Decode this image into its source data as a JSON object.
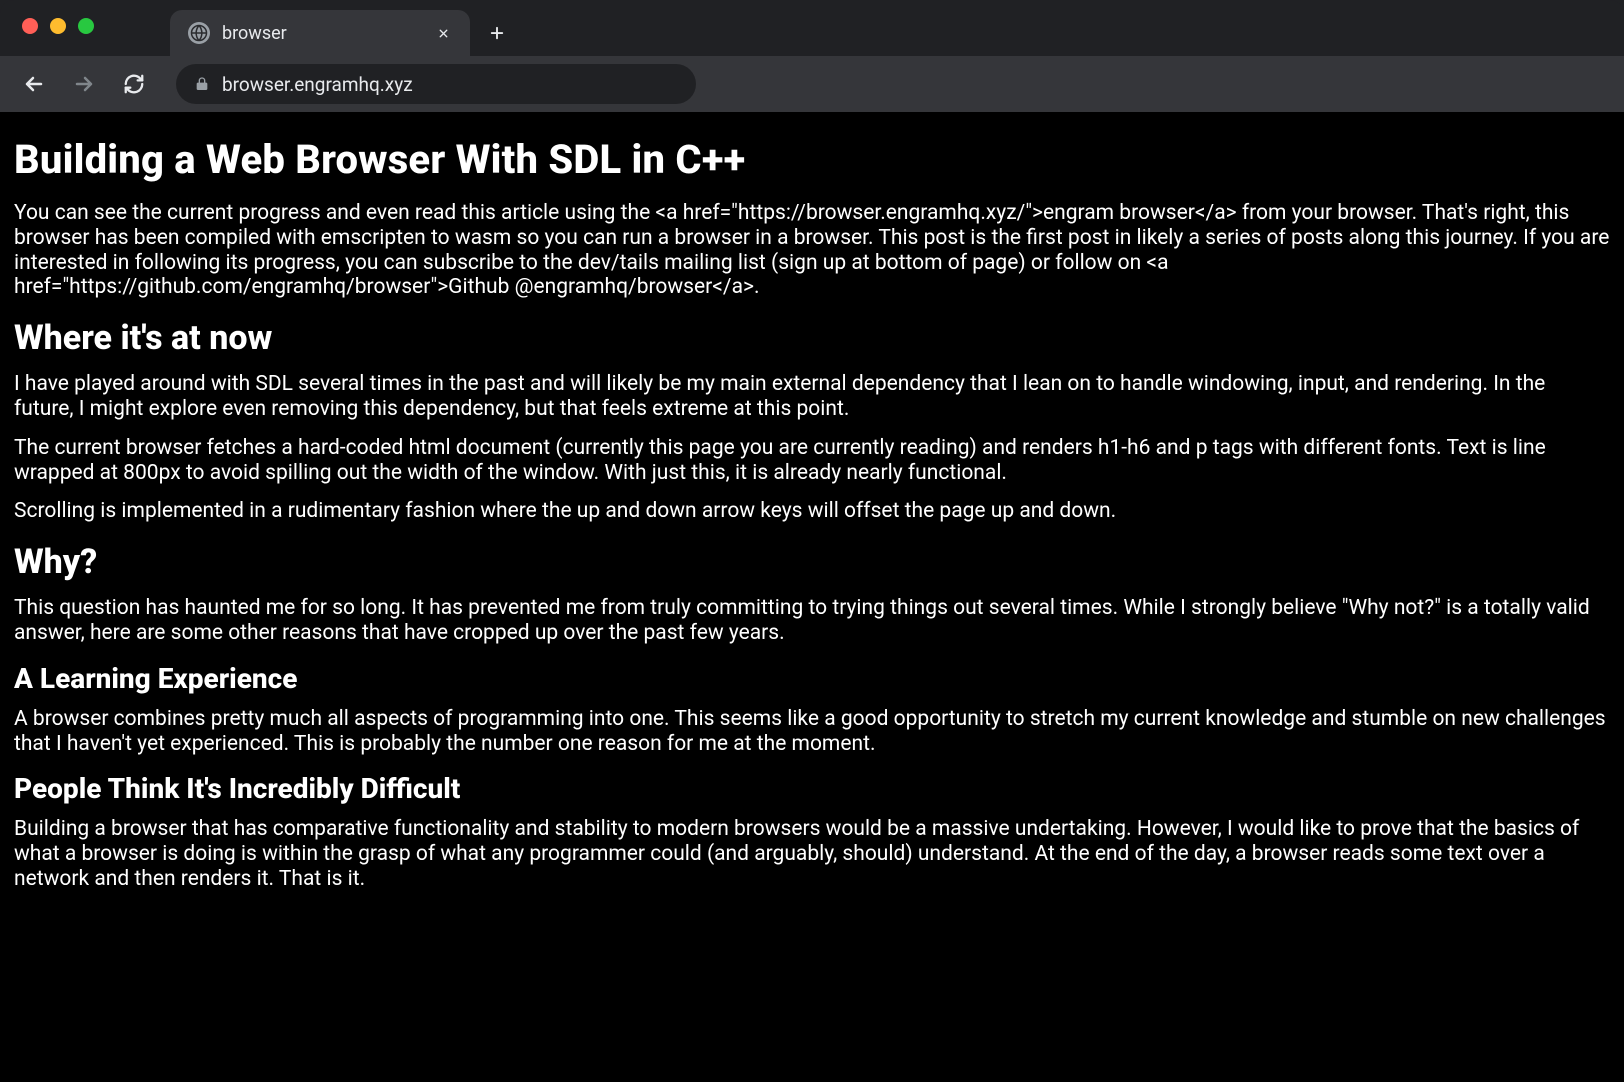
{
  "tab": {
    "title": "browser"
  },
  "address": {
    "url": "browser.engramhq.xyz"
  },
  "page": {
    "h1": "Building a Web Browser With SDL in C++",
    "p_intro": "You can see the current progress and even read this article using the <a href=\"https://browser.engramhq.xyz/\">engram browser</a> from your browser.  That's right, this browser has been compiled with emscripten to wasm so you can run a browser in a browser.  This post is the first post in likely a series of posts along this journey.  If you are interested in following its progress, you can subscribe to the dev/tails mailing list (sign up at bottom of page) or follow on <a href=\"https://github.com/engramhq/browser\">Github @engramhq/browser</a>.",
    "h2_where": "Where it's at now",
    "p_where_1": "I have played around with SDL several times in the past and will likely be my main external dependency that I lean on to handle windowing, input, and rendering.  In the future, I might explore even removing this dependency, but that feels extreme at this point.",
    "p_where_2": "The current browser fetches a hard-coded html document (currently this page you are currently reading) and renders h1-h6 and p tags with different fonts.  Text is line wrapped at 800px to avoid spilling out the width of the window.  With just this, it is already nearly functional.",
    "p_where_3": "Scrolling is implemented in a rudimentary fashion where the up and down arrow keys will offset the page up and down.",
    "h2_why": "Why?",
    "p_why_1": "This question has haunted me for so long.  It has prevented me from truly committing to trying things out several times. While I strongly believe \"Why not?\" is a totally valid answer, here are some other reasons that have cropped up over the past few years.",
    "h3_learning": "A Learning Experience",
    "p_learning_1": "A browser combines pretty much all aspects of programming into one.  This seems like a good opportunity to stretch my current knowledge and stumble on new challenges that I haven't yet experienced. This is probably the number one reason for me at the moment.",
    "h3_difficult": "People Think It's Incredibly Difficult",
    "p_difficult_1": "Building a browser that has comparative functionality and stability to modern browsers would be a massive undertaking.  However, I would like to prove that the basics of what a browser is doing is within the grasp of what any programmer could (and arguably, should) understand.  At the end of the day, a browser reads some text over a network and then renders it.  That is it."
  }
}
